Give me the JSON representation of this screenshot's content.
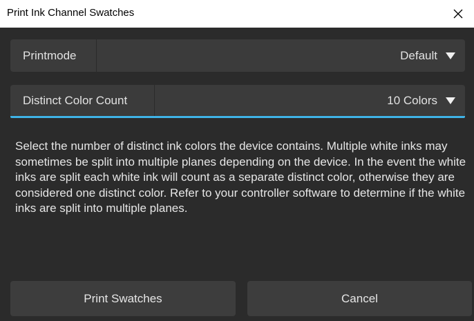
{
  "window": {
    "title": "Print Ink Channel Swatches"
  },
  "printmode": {
    "label": "Printmode",
    "value": "Default"
  },
  "color_count": {
    "label": "Distinct Color Count",
    "value": "10 Colors"
  },
  "description": "Select the number of distinct ink colors the device contains. Multiple white inks may sometimes be split into multiple planes depending on the device. In the event the white inks are split each white ink will count as a separate distinct color, otherwise they are considered one distinct color. Refer to your controller software to determine if the white inks are split into multiple planes.",
  "buttons": {
    "print_label": "Print Swatches",
    "cancel_label": "Cancel"
  },
  "colors": {
    "background": "#2b2b2b",
    "row_background": "#3b3b3b",
    "accent": "#3fb4e8",
    "titlebar": "#ffffff"
  }
}
